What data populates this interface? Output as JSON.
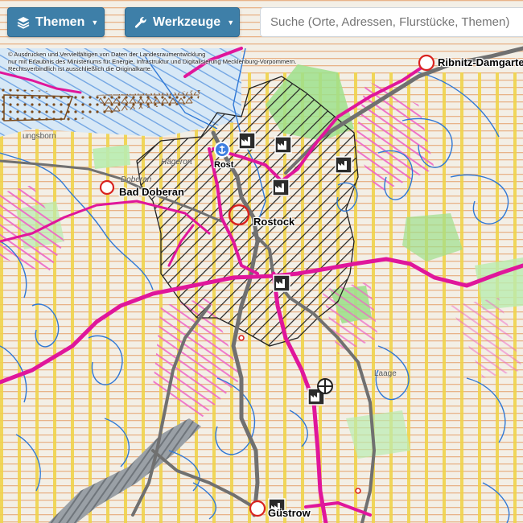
{
  "toolbar": {
    "themen_label": "Themen",
    "werkzeuge_label": "Werkzeuge",
    "search_placeholder": "Suche (Orte, Adressen, Flurstücke, Themen)"
  },
  "attribution": {
    "line1": "© Ausdrucken und Vervielfältigen von Daten der Landesraumentwicklung",
    "line2": "nur mit Erlaubnis des Ministeriums für Energie, Infrastruktur und Digitalisierung Mecklenburg-Vorpommern.",
    "line3": "Rechtsverbindlich ist ausschließlich die Originalkarte."
  },
  "map": {
    "cities": [
      {
        "name": "Rostock"
      },
      {
        "name": "Bad Doberan"
      },
      {
        "name": "Ribnitz-Damgarten"
      },
      {
        "name": "Güstrow"
      }
    ],
    "minor_labels": [
      "Doberan",
      "Rost",
      "Hägerort",
      "Laage",
      "ungsborn"
    ],
    "colors": {
      "base": "#f3efe6",
      "road_magenta": "#e0169b",
      "road_gray": "#6e6e6e",
      "water_lines": "#2f78d6",
      "yellow_stripes": "#f0d34a",
      "orange_lines": "#e8a060",
      "green": "#9ee08c",
      "hatch": "#222222",
      "city_ring": "#d9231f"
    }
  }
}
